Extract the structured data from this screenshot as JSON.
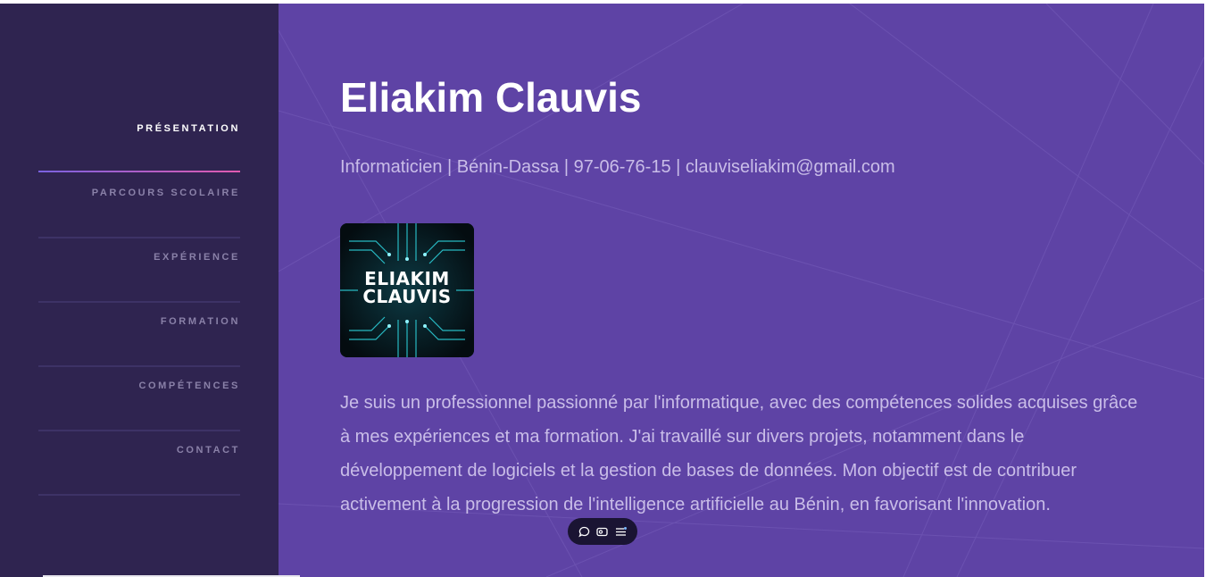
{
  "nav": {
    "items": [
      {
        "label": "Présentation",
        "active": true
      },
      {
        "label": "Parcours scolaire",
        "active": false
      },
      {
        "label": "Expérience",
        "active": false
      },
      {
        "label": "Formation",
        "active": false
      },
      {
        "label": "Compétences",
        "active": false
      },
      {
        "label": "Contact",
        "active": false
      }
    ]
  },
  "profile": {
    "name": "Eliakim Clauvis",
    "subtitle": "Informaticien | Bénin-Dassa | 97-06-76-15 | clauviseliakim@gmail.com",
    "logo_line1": "ELIAKIM",
    "logo_line2": "CLAUVIS",
    "bio": "Je suis un professionnel passionné par l'informatique, avec des compétences solides acquises grâce à mes expériences et ma formation. J'ai travaillé sur divers projets, notamment dans le développement de logiciels et la gestion de bases de données. Mon objectif est de contribuer activement à la progression de l'intelligence artificielle au Bénin, en favorisant l'innovation."
  },
  "floating_toolbar": {
    "icons": [
      "comment-icon",
      "caption-icon",
      "menu-icon"
    ]
  },
  "colors": {
    "sidebar": "#2f2450",
    "main": "#5e43a5",
    "accent_start": "#7a62e0",
    "accent_end": "#e15bb0"
  }
}
